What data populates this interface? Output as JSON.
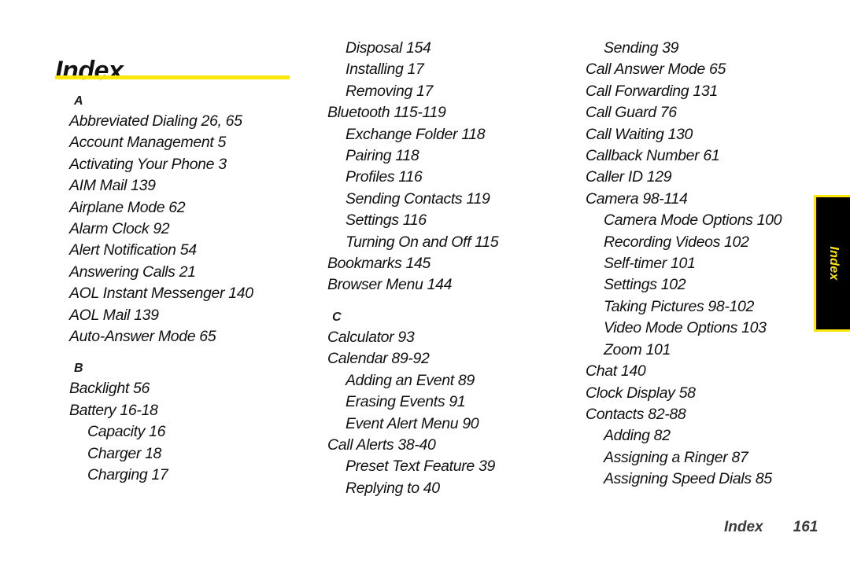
{
  "page": {
    "title": "Index",
    "accent_color": "#ffe60a",
    "text_color": "#111111",
    "background_color": "#ffffff"
  },
  "side_tab": {
    "label": "Index",
    "background_color": "#000000",
    "border_color": "#ffe60a",
    "text_color": "#ffe60a"
  },
  "footer": {
    "label": "Index",
    "page_number": "161"
  },
  "columns": [
    {
      "id": "column-1",
      "sections": [
        {
          "letter": "A",
          "entries": [
            {
              "text": "Abbreviated Dialing 26,  65",
              "level": 1
            },
            {
              "text": "Account Management 5",
              "level": 1
            },
            {
              "text": "Activating Your Phone 3",
              "level": 1
            },
            {
              "text": "AIM Mail 139",
              "level": 1
            },
            {
              "text": "Airplane Mode 62",
              "level": 1
            },
            {
              "text": "Alarm Clock 92",
              "level": 1
            },
            {
              "text": "Alert Notification 54",
              "level": 1
            },
            {
              "text": "Answering Calls 21",
              "level": 1
            },
            {
              "text": "AOL Instant Messenger 140",
              "level": 1
            },
            {
              "text": "AOL Mail 139",
              "level": 1
            },
            {
              "text": "Auto-Answer Mode 65",
              "level": 1
            }
          ]
        },
        {
          "letter": "B",
          "entries": [
            {
              "text": "Backlight 56",
              "level": 1
            },
            {
              "text": "Battery 16-18",
              "level": 1
            },
            {
              "text": "Capacity 16",
              "level": 2
            },
            {
              "text": "Charger 18",
              "level": 2
            },
            {
              "text": "Charging 17",
              "level": 2
            }
          ]
        }
      ]
    },
    {
      "id": "column-2",
      "sections": [
        {
          "letter": "",
          "entries": [
            {
              "text": "Disposal 154",
              "level": 2
            },
            {
              "text": "Installing 17",
              "level": 2
            },
            {
              "text": "Removing 17",
              "level": 2
            },
            {
              "text": "Bluetooth 115-119",
              "level": 1
            },
            {
              "text": "Exchange Folder 118",
              "level": 2
            },
            {
              "text": "Pairing 118",
              "level": 2
            },
            {
              "text": "Profiles 116",
              "level": 2
            },
            {
              "text": "Sending Contacts 119",
              "level": 2
            },
            {
              "text": "Settings 116",
              "level": 2
            },
            {
              "text": "Turning On and Off 115",
              "level": 2
            },
            {
              "text": "Bookmarks 145",
              "level": 1
            },
            {
              "text": "Browser Menu 144",
              "level": 1
            }
          ]
        },
        {
          "letter": "C",
          "entries": [
            {
              "text": "Calculator 93",
              "level": 1
            },
            {
              "text": "Calendar 89-92",
              "level": 1
            },
            {
              "text": "Adding an Event 89",
              "level": 2
            },
            {
              "text": "Erasing Events 91",
              "level": 2
            },
            {
              "text": "Event Alert Menu 90",
              "level": 2
            },
            {
              "text": "Call Alerts 38-40",
              "level": 1
            },
            {
              "text": "Preset Text Feature 39",
              "level": 2
            },
            {
              "text": "Replying to 40",
              "level": 2
            }
          ]
        }
      ]
    },
    {
      "id": "column-3",
      "sections": [
        {
          "letter": "",
          "entries": [
            {
              "text": "Sending 39",
              "level": 2
            },
            {
              "text": "Call Answer Mode 65",
              "level": 1
            },
            {
              "text": "Call Forwarding 131",
              "level": 1
            },
            {
              "text": "Call Guard 76",
              "level": 1
            },
            {
              "text": "Call Waiting 130",
              "level": 1
            },
            {
              "text": "Callback Number 61",
              "level": 1
            },
            {
              "text": "Caller ID 129",
              "level": 1
            },
            {
              "text": "Camera 98-114",
              "level": 1
            },
            {
              "text": "Camera Mode Options 100",
              "level": 2
            },
            {
              "text": "Recording Videos 102",
              "level": 2
            },
            {
              "text": "Self-timer 101",
              "level": 2
            },
            {
              "text": "Settings 102",
              "level": 2
            },
            {
              "text": "Taking Pictures 98-102",
              "level": 2
            },
            {
              "text": "Video Mode Options 103",
              "level": 2
            },
            {
              "text": "Zoom 101",
              "level": 2
            },
            {
              "text": "Chat 140",
              "level": 1
            },
            {
              "text": "Clock Display 58",
              "level": 1
            },
            {
              "text": "Contacts 82-88",
              "level": 1
            },
            {
              "text": "Adding 82",
              "level": 2
            },
            {
              "text": "Assigning a Ringer 87",
              "level": 2
            },
            {
              "text": "Assigning Speed Dials 85",
              "level": 2
            }
          ]
        }
      ]
    }
  ]
}
